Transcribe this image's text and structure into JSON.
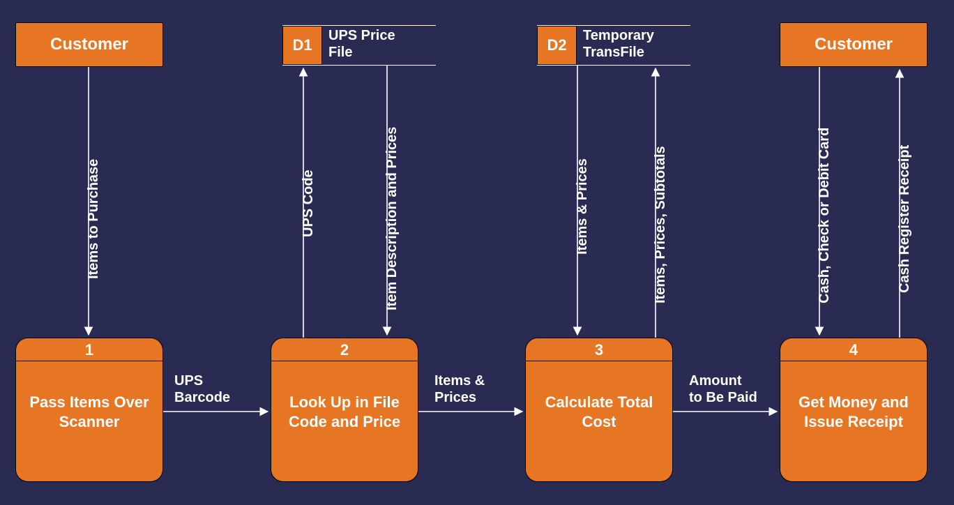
{
  "entities": {
    "customer_left": "Customer",
    "customer_right": "Customer"
  },
  "datastores": {
    "d1": {
      "id": "D1",
      "label": "UPS Price\nFile"
    },
    "d2": {
      "id": "D2",
      "label": "Temporary\nTransFile"
    }
  },
  "processes": {
    "p1": {
      "id": "1",
      "label": "Pass Items Over Scanner"
    },
    "p2": {
      "id": "2",
      "label": "Look Up in File Code and Price"
    },
    "p3": {
      "id": "3",
      "label": "Calculate Total Cost"
    },
    "p4": {
      "id": "4",
      "label": "Get Money and Issue Receipt"
    }
  },
  "flows": {
    "f_cust_p1": "Items to Purchase",
    "f_p1_p2": "UPS\nBarcode",
    "f_p2_d1_up": "UPS Code",
    "f_d1_p2_down": "Item Description and Prices",
    "f_p2_p3": "Items &\nPrices",
    "f_d2_p3_down": "Items & Prices",
    "f_p3_d2_up": "Items, Prices, Subtotals",
    "f_p3_p4": "Amount\nto Be Paid",
    "f_cust_p4_down": "Cash, Check or Debit Card",
    "f_p4_cust_up": "Cash Register Receipt"
  }
}
